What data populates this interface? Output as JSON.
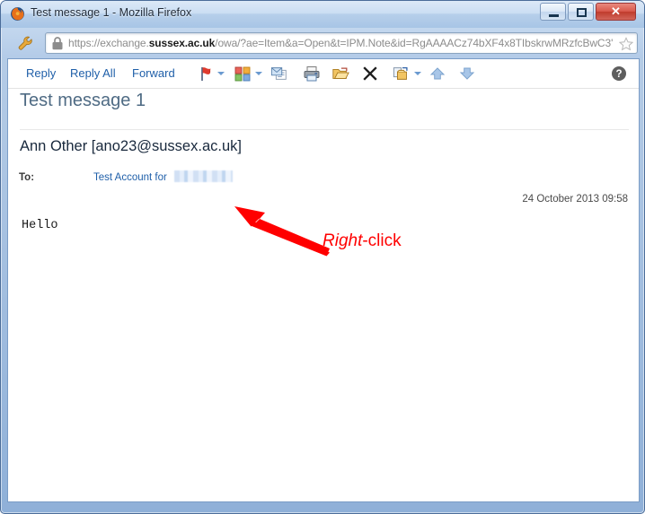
{
  "window": {
    "title": "Test message 1 - Mozilla Firefox",
    "favicon": "firefox-icon",
    "controls": {
      "minimize_label": "Minimize",
      "maximize_label": "Maximize",
      "close_label": "Close",
      "close_glyph": "✕"
    }
  },
  "navbar": {
    "wrench_icon": "wrench-icon",
    "lock_icon": "padlock-icon",
    "star_icon": "bookmark-star-icon",
    "url_scheme": "https://exchange.",
    "url_host": "sussex.ac.uk",
    "url_path": "/owa/?ae=Item&a=Open&t=IPM.Note&id=RgAAAACz74bXF4x8TIbskrwMRzfcBwC3'"
  },
  "toolbar": {
    "reply": "Reply",
    "reply_all": "Reply All",
    "forward": "Forward",
    "icons": [
      {
        "name": "flag-icon",
        "tooltip": "Follow Up"
      },
      {
        "name": "categorize-icon",
        "tooltip": "Categorize"
      },
      {
        "name": "mark-unread-icon",
        "tooltip": "Mark as Unread"
      },
      {
        "name": "print-icon",
        "tooltip": "Print"
      },
      {
        "name": "open-folder-icon",
        "tooltip": "Move to Folder"
      },
      {
        "name": "delete-icon",
        "tooltip": "Delete"
      },
      {
        "name": "copy-to-folder-icon",
        "tooltip": "Copy to Folder"
      },
      {
        "name": "arrow-up-icon",
        "tooltip": "Previous Item"
      },
      {
        "name": "arrow-down-icon",
        "tooltip": "Next Item"
      },
      {
        "name": "help-icon",
        "tooltip": "Help"
      }
    ]
  },
  "message": {
    "subject": "Test message 1",
    "from": "Ann Other [ano23@sussex.ac.uk]",
    "to_label": "To:",
    "to_value": "Test Account for",
    "to_redacted": true,
    "date": "24 October 2013 09:58",
    "body": "Hello"
  },
  "annotation": {
    "text_italic": "Right",
    "text_plain": "-click",
    "color": "#ff0000",
    "arrow_name": "red-callout-arrow"
  },
  "colors": {
    "link_blue": "#1f5fa9",
    "subject_gray": "#4f6b84",
    "annotation_red": "#ff0000",
    "frame_blue": "#8fb0d8"
  }
}
